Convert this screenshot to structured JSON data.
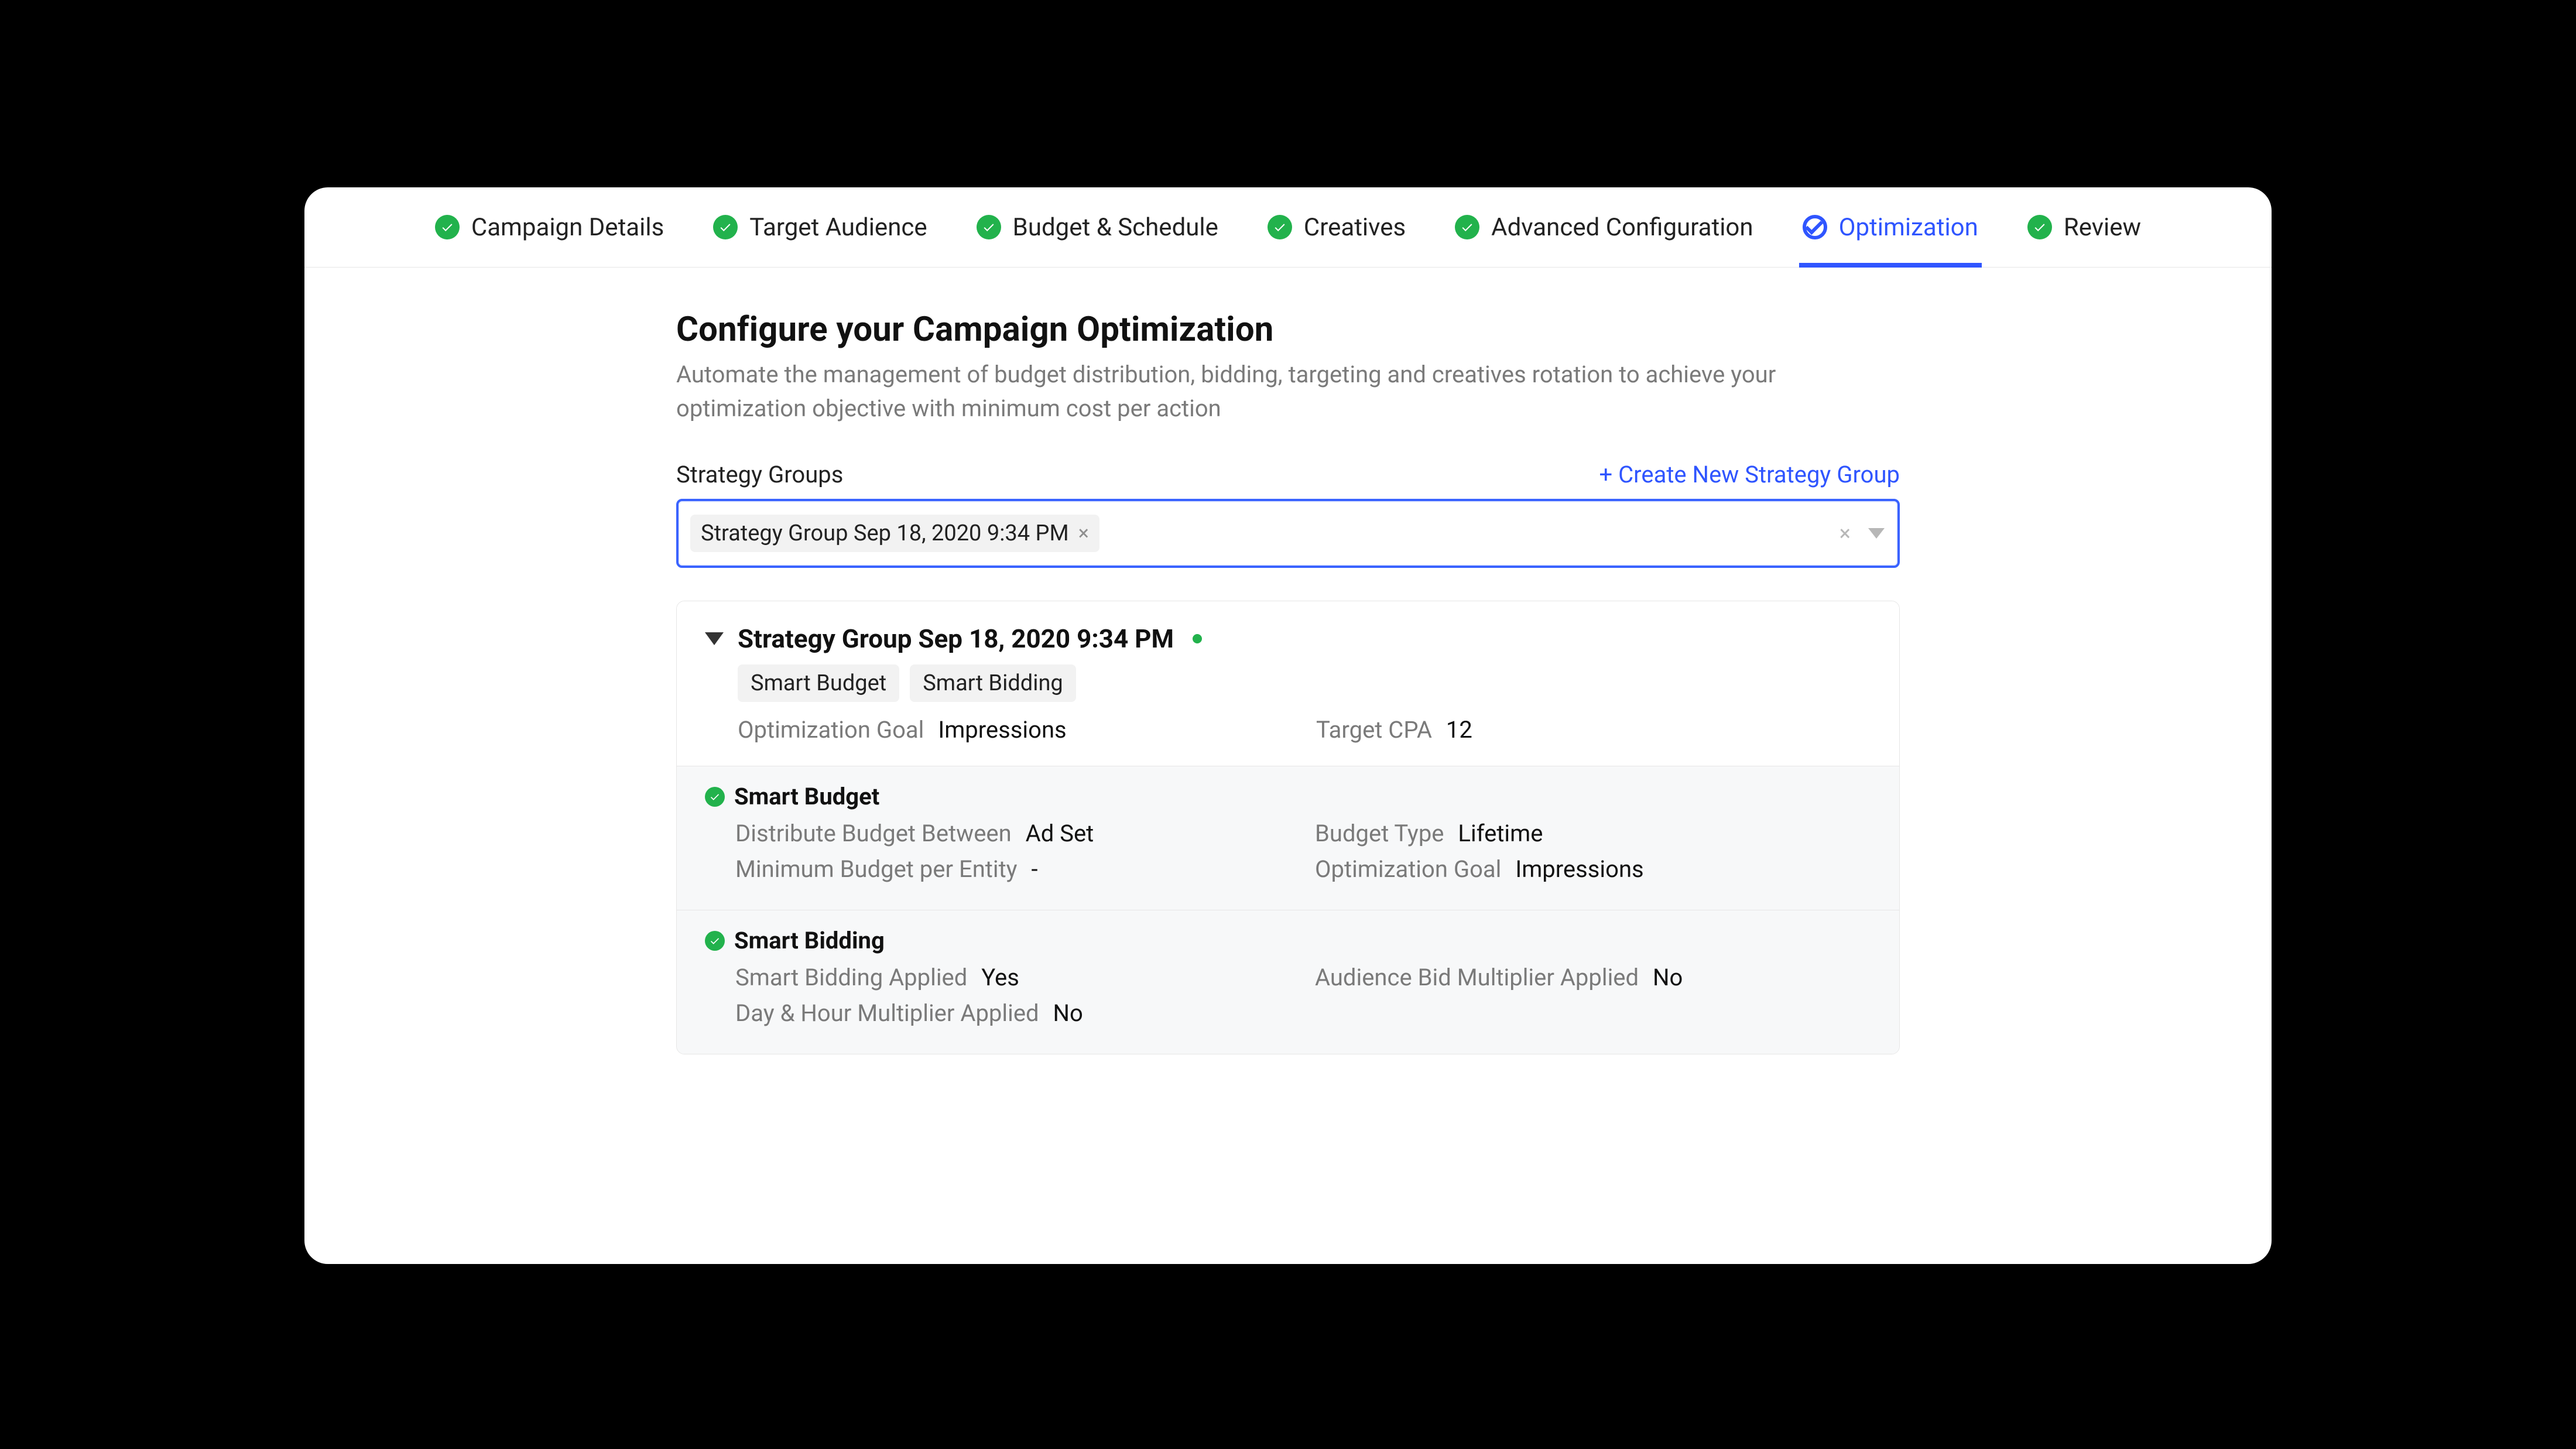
{
  "colors": {
    "accent": "#2f55ff",
    "green": "#22b24c"
  },
  "steps": [
    {
      "label": "Campaign Details",
      "state": "done"
    },
    {
      "label": "Target Audience",
      "state": "done"
    },
    {
      "label": "Budget & Schedule",
      "state": "done"
    },
    {
      "label": "Creatives",
      "state": "done"
    },
    {
      "label": "Advanced Configuration",
      "state": "done"
    },
    {
      "label": "Optimization",
      "state": "current"
    },
    {
      "label": "Review",
      "state": "done"
    }
  ],
  "header": {
    "title_prefix": "Configure your Campaign ",
    "title_bold": "Optimization",
    "subtitle": "Automate the management of budget distribution, bidding, targeting and creatives rotation to achieve your optimization objective with minimum cost per action"
  },
  "strategy": {
    "section_label": "Strategy Groups",
    "create_link": "+ Create New Strategy Group",
    "selected_chip": "Strategy Group Sep 18, 2020 9:34 PM",
    "clear_icon": "×",
    "card": {
      "title": "Strategy Group Sep 18, 2020 9:34 PM",
      "tags": [
        "Smart Budget",
        "Smart Bidding"
      ],
      "fields": {
        "optimization_goal_label": "Optimization Goal",
        "optimization_goal_value": "Impressions",
        "target_cpa_label": "Target CPA",
        "target_cpa_value": "12"
      },
      "sections": [
        {
          "title": "Smart Budget",
          "rows": [
            {
              "k": "Distribute Budget Between",
              "v": "Ad Set"
            },
            {
              "k": "Budget Type",
              "v": "Lifetime"
            },
            {
              "k": "Minimum Budget per Entity",
              "v": "-"
            },
            {
              "k": "Optimization Goal",
              "v": "Impressions"
            }
          ]
        },
        {
          "title": "Smart Bidding",
          "rows": [
            {
              "k": "Smart Bidding Applied",
              "v": "Yes"
            },
            {
              "k": "Audience Bid Multiplier Applied",
              "v": "No"
            },
            {
              "k": "Day & Hour Multiplier Applied",
              "v": "No"
            }
          ]
        }
      ]
    }
  }
}
